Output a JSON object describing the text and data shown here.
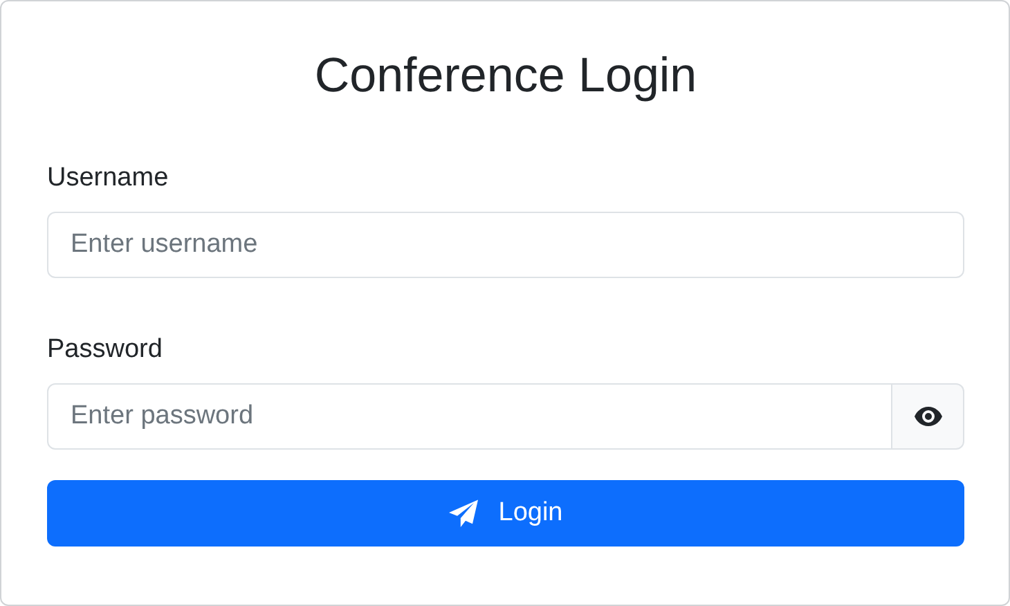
{
  "title": "Conference Login",
  "fields": [
    {
      "label": "Username",
      "placeholder": "Enter username",
      "kind": "text"
    },
    {
      "label": "Password",
      "placeholder": "Enter password",
      "kind": "password"
    }
  ],
  "submit": {
    "label": "Login"
  }
}
